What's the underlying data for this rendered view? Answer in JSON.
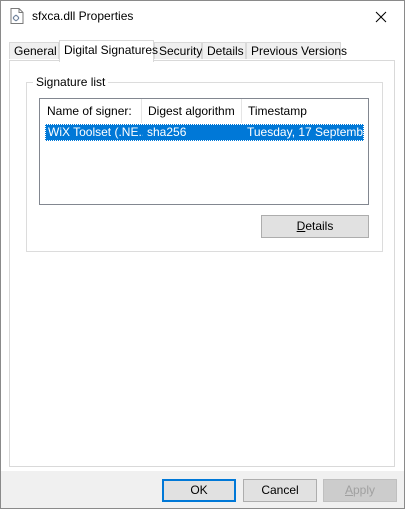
{
  "window": {
    "title": "sfxca.dll Properties"
  },
  "tabs": [
    {
      "label": "General"
    },
    {
      "label": "Digital Signatures"
    },
    {
      "label": "Security"
    },
    {
      "label": "Details"
    },
    {
      "label": "Previous Versions"
    }
  ],
  "signature_group": {
    "label": "Signature list",
    "columns": [
      "Name of signer:",
      "Digest algorithm",
      "Timestamp"
    ],
    "rows": [
      {
        "signer": "WiX Toolset (.NE...",
        "digest": "sha256",
        "timestamp": "Tuesday, 17 Septemb..."
      }
    ],
    "details_button": "Details"
  },
  "footer": {
    "ok": "OK",
    "cancel": "Cancel",
    "apply": "Apply"
  },
  "colors": {
    "selection": "#0078d7",
    "button_face": "#e1e1e1",
    "footer_bg": "#f0f0f0"
  }
}
